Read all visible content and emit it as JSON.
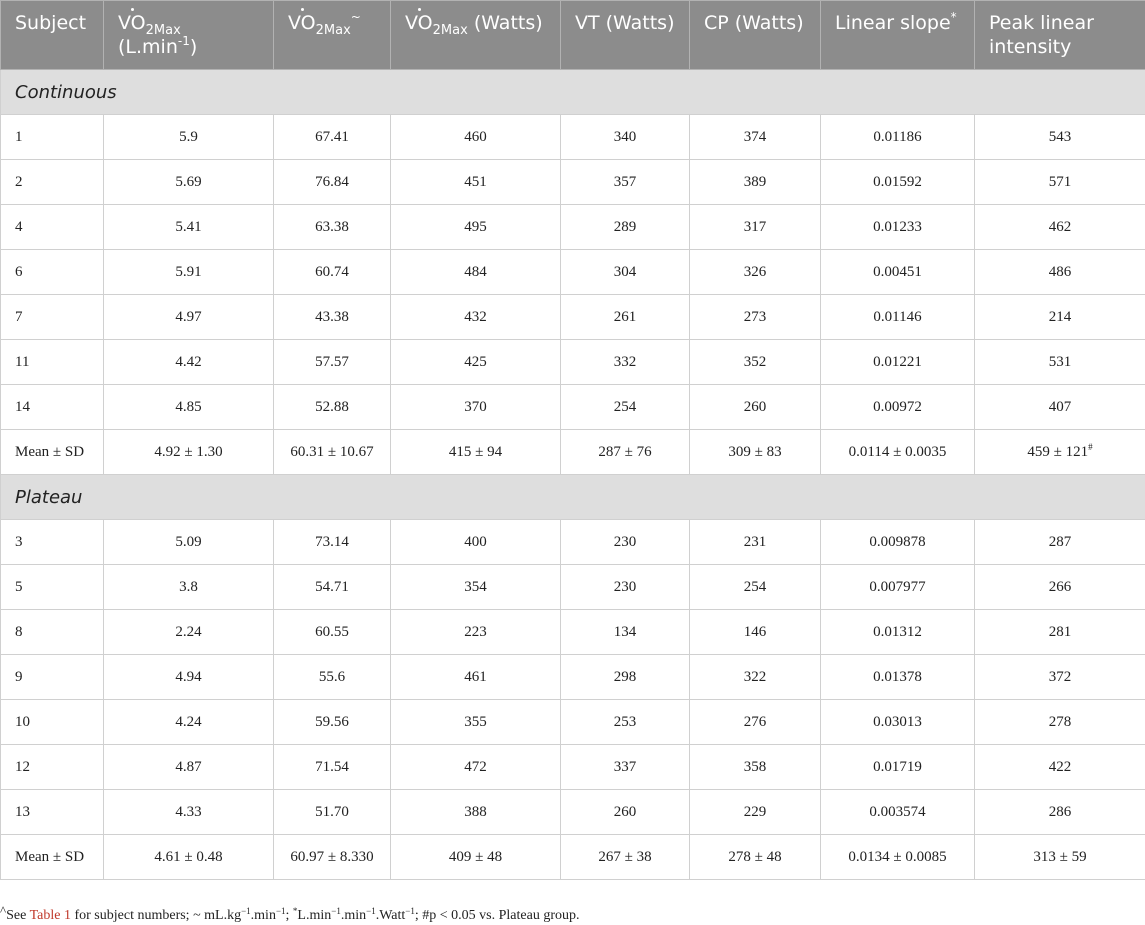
{
  "table": {
    "headers": {
      "subject": "Subject",
      "vo2max_l_main": "VO",
      "vo2max_l_sub": "2Max",
      "vo2max_l_unit": "(L.min",
      "vo2max_l_unit_sup": "-1",
      "vo2max_l_unit_end": ")",
      "vo2max_rel_main": "VO",
      "vo2max_rel_sub": "2Max",
      "vo2max_rel_sup": "~",
      "vo2max_w_main": "VO",
      "vo2max_w_sub": "2Max",
      "vo2max_w_unit": " (Watts)",
      "vt": "VT (Watts)",
      "cp": "CP (Watts)",
      "slope": "Linear slope",
      "slope_sup": "*",
      "peak": "Peak linear intensity"
    },
    "groups": [
      {
        "label": "Continuous",
        "rows": [
          [
            "1",
            "5.9",
            "67.41",
            "460",
            "340",
            "374",
            "0.01186",
            "543"
          ],
          [
            "2",
            "5.69",
            "76.84",
            "451",
            "357",
            "389",
            "0.01592",
            "571"
          ],
          [
            "4",
            "5.41",
            "63.38",
            "495",
            "289",
            "317",
            "0.01233",
            "462"
          ],
          [
            "6",
            "5.91",
            "60.74",
            "484",
            "304",
            "326",
            "0.00451",
            "486"
          ],
          [
            "7",
            "4.97",
            "43.38",
            "432",
            "261",
            "273",
            "0.01146",
            "214"
          ],
          [
            "11",
            "4.42",
            "57.57",
            "425",
            "332",
            "352",
            "0.01221",
            "531"
          ],
          [
            "14",
            "4.85",
            "52.88",
            "370",
            "254",
            "260",
            "0.00972",
            "407"
          ]
        ],
        "mean": [
          "Mean ± SD",
          "4.92 ± 1.30",
          "60.31 ± 10.67",
          "415 ± 94",
          "287 ± 76",
          "309 ± 83",
          "0.0114 ± 0.0035",
          "459 ± 121"
        ],
        "mean_peak_sup": "#"
      },
      {
        "label": "Plateau",
        "rows": [
          [
            "3",
            "5.09",
            "73.14",
            "400",
            "230",
            "231",
            "0.009878",
            "287"
          ],
          [
            "5",
            "3.8",
            "54.71",
            "354",
            "230",
            "254",
            "0.007977",
            "266"
          ],
          [
            "8",
            "2.24",
            "60.55",
            "223",
            "134",
            "146",
            "0.01312",
            "281"
          ],
          [
            "9",
            "4.94",
            "55.6",
            "461",
            "298",
            "322",
            "0.01378",
            "372"
          ],
          [
            "10",
            "4.24",
            "59.56",
            "355",
            "253",
            "276",
            "0.03013",
            "278"
          ],
          [
            "12",
            "4.87",
            "71.54",
            "472",
            "337",
            "358",
            "0.01719",
            "422"
          ],
          [
            "13",
            "4.33",
            "51.70",
            "388",
            "260",
            "229",
            "0.003574",
            "286"
          ]
        ],
        "mean": [
          "Mean ± SD",
          "4.61 ± 0.48",
          "60.97 ± 8.330",
          "409 ± 48",
          "267 ± 38",
          "278 ± 48",
          "0.0134 ± 0.0085",
          "313 ± 59"
        ],
        "mean_peak_sup": ""
      }
    ]
  },
  "footnote": {
    "mark": "^",
    "see": "See",
    "link": "Table 1",
    "part1": "for subject numbers; ~ mL.kg",
    "sup1": "−1",
    "part2": ".min",
    "sup2": "−1",
    "part3": ";",
    "sup3": "*",
    "part4": "L.min",
    "sup4": "−1",
    "part5": ".min",
    "sup5": "−1",
    "part6": ".Watt",
    "sup6": "−1",
    "part7": "; #p < 0.05 vs. Plateau group."
  }
}
